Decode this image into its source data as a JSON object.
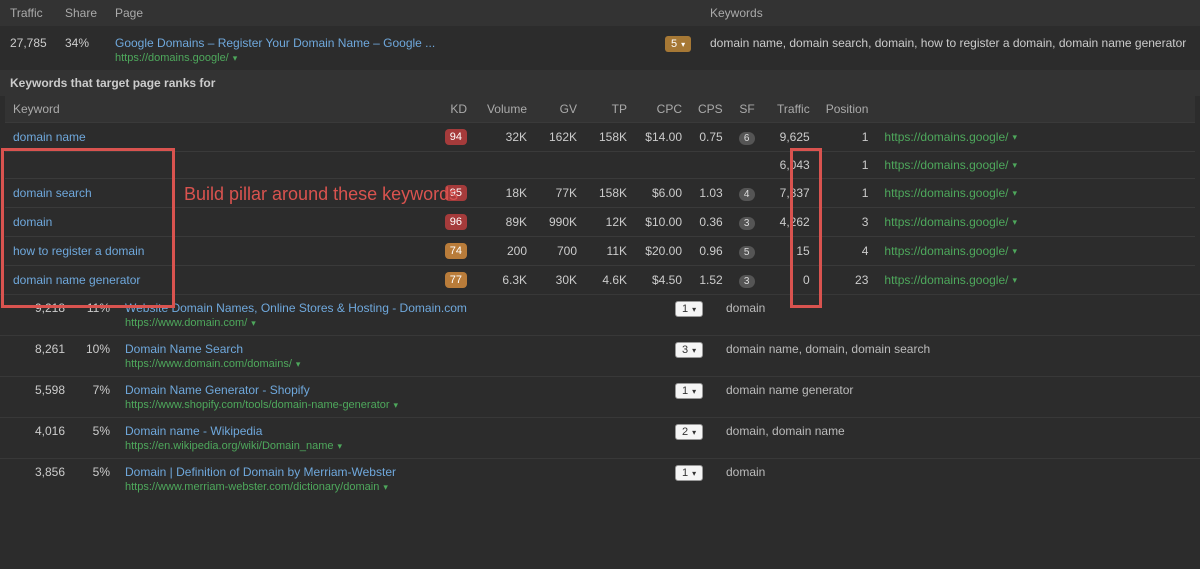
{
  "header": {
    "traffic": "Traffic",
    "share": "Share",
    "page": "Page",
    "keywords": "Keywords"
  },
  "topRow": {
    "traffic": "27,785",
    "share": "34%",
    "pageTitle": "Google Domains – Register Your Domain Name – Google ...",
    "pageUrl": "https://domains.google/",
    "kwBadge": "5",
    "kwList": "domain name, domain search, domain, how to register a domain, domain name generator"
  },
  "sectionTitle": "Keywords that target page ranks for",
  "kwHeaders": {
    "keyword": "Keyword",
    "kd": "KD",
    "volume": "Volume",
    "gv": "GV",
    "tp": "TP",
    "cpc": "CPC",
    "cps": "CPS",
    "sf": "SF",
    "traffic": "Traffic",
    "position": "Position"
  },
  "kwRows": [
    {
      "keyword": "domain name",
      "kd": "94",
      "kdClass": "kd-red",
      "volume": "32K",
      "gv": "162K",
      "tp": "158K",
      "cpc": "$14.00",
      "cps": "0.75",
      "sf": "6",
      "traffic": "9,625",
      "position": "1",
      "url": "https://domains.google/"
    },
    {
      "keyword": "",
      "kd": "",
      "kdClass": "",
      "volume": "",
      "gv": "",
      "tp": "",
      "cpc": "",
      "cps": "",
      "sf": "",
      "traffic": "6,043",
      "position": "1",
      "url": "https://domains.google/"
    },
    {
      "keyword": "domain search",
      "kd": "95",
      "kdClass": "kd-red",
      "volume": "18K",
      "gv": "77K",
      "tp": "158K",
      "cpc": "$6.00",
      "cps": "1.03",
      "sf": "4",
      "traffic": "7,837",
      "position": "1",
      "url": "https://domains.google/"
    },
    {
      "keyword": "domain",
      "kd": "96",
      "kdClass": "kd-red",
      "volume": "89K",
      "gv": "990K",
      "tp": "12K",
      "cpc": "$10.00",
      "cps": "0.36",
      "sf": "3",
      "traffic": "4,262",
      "position": "3",
      "url": "https://domains.google/"
    },
    {
      "keyword": "how to register a domain",
      "kd": "74",
      "kdClass": "kd-or",
      "volume": "200",
      "gv": "700",
      "tp": "11K",
      "cpc": "$20.00",
      "cps": "0.96",
      "sf": "5",
      "traffic": "15",
      "position": "4",
      "url": "https://domains.google/"
    },
    {
      "keyword": "domain name generator",
      "kd": "77",
      "kdClass": "kd-or",
      "volume": "6.3K",
      "gv": "30K",
      "tp": "4.6K",
      "cpc": "$4.50",
      "cps": "1.52",
      "sf": "3",
      "traffic": "0",
      "position": "23",
      "url": "https://domains.google/"
    }
  ],
  "results": [
    {
      "traffic": "9,218",
      "share": "11%",
      "title": "Website Domain Names, Online Stores & Hosting - Domain.com",
      "url": "https://www.domain.com/",
      "count": "1",
      "kws": "domain"
    },
    {
      "traffic": "8,261",
      "share": "10%",
      "title": "Domain Name Search",
      "url": "https://www.domain.com/domains/",
      "count": "3",
      "kws": "domain name, domain, domain search"
    },
    {
      "traffic": "5,598",
      "share": "7%",
      "title": "Domain Name Generator - Shopify",
      "url": "https://www.shopify.com/tools/domain-name-generator",
      "count": "1",
      "kws": "domain name generator"
    },
    {
      "traffic": "4,016",
      "share": "5%",
      "title": "Domain name - Wikipedia",
      "url": "https://en.wikipedia.org/wiki/Domain_name",
      "count": "2",
      "kws": "domain, domain name"
    },
    {
      "traffic": "3,856",
      "share": "5%",
      "title": "Domain | Definition of Domain by Merriam-Webster",
      "url": "https://www.merriam-webster.com/dictionary/domain",
      "count": "1",
      "kws": "domain"
    }
  ],
  "annotation": "Build pillar around these keywords"
}
